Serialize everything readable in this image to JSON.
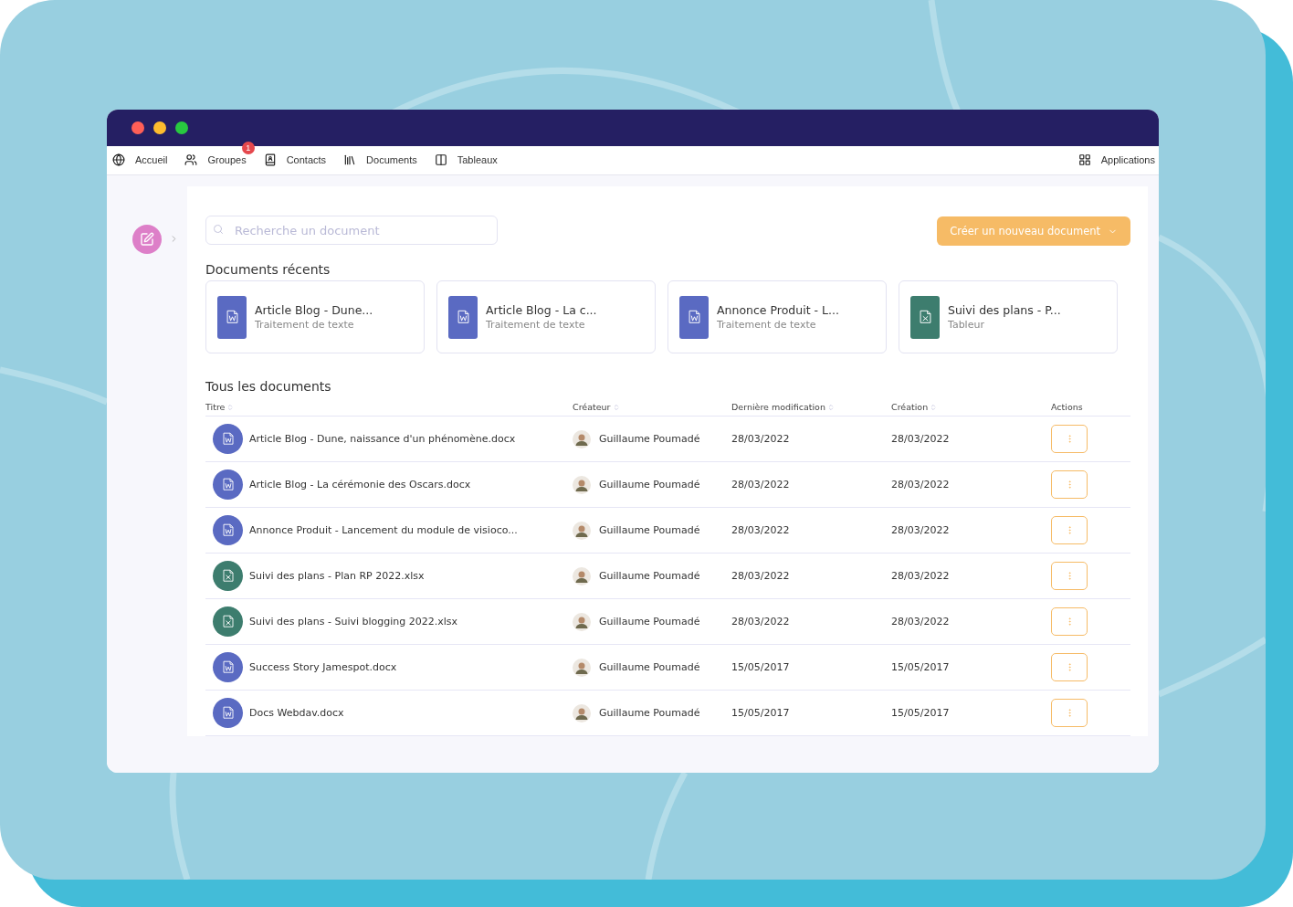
{
  "nav": {
    "items": [
      {
        "label": "Accueil"
      },
      {
        "label": "Groupes",
        "badge": "1"
      },
      {
        "label": "Contacts"
      },
      {
        "label": "Documents"
      },
      {
        "label": "Tableaux"
      }
    ],
    "apps": "Applications"
  },
  "search": {
    "placeholder": "Recherche un document"
  },
  "create_button": "Créer un nouveau document",
  "recent": {
    "title": "Documents récents",
    "items": [
      {
        "name": "Article Blog - Dune...",
        "type": "Traitement de texte",
        "kind": "word"
      },
      {
        "name": "Article Blog - La c...",
        "type": "Traitement de texte",
        "kind": "word"
      },
      {
        "name": "Annonce Produit - L...",
        "type": "Traitement de texte",
        "kind": "word"
      },
      {
        "name": "Suivi des plans - P...",
        "type": "Tableur",
        "kind": "sheet"
      }
    ]
  },
  "table": {
    "title": "Tous les documents",
    "columns": [
      "Titre",
      "Créateur",
      "Dernière modification",
      "Création",
      "Actions"
    ],
    "rows": [
      {
        "kind": "word",
        "title": "Article Blog - Dune, naissance d'un phénomène.docx",
        "creator": "Guillaume Poumadé",
        "modified": "28/03/2022",
        "created": "28/03/2022"
      },
      {
        "kind": "word",
        "title": "Article Blog - La cérémonie des Oscars.docx",
        "creator": "Guillaume Poumadé",
        "modified": "28/03/2022",
        "created": "28/03/2022"
      },
      {
        "kind": "word",
        "title": "Annonce Produit - Lancement du module de visioco...",
        "creator": "Guillaume Poumadé",
        "modified": "28/03/2022",
        "created": "28/03/2022"
      },
      {
        "kind": "sheet",
        "title": "Suivi des plans - Plan RP 2022.xlsx",
        "creator": "Guillaume Poumadé",
        "modified": "28/03/2022",
        "created": "28/03/2022"
      },
      {
        "kind": "sheet",
        "title": "Suivi des plans - Suivi blogging 2022.xlsx",
        "creator": "Guillaume Poumadé",
        "modified": "28/03/2022",
        "created": "28/03/2022"
      },
      {
        "kind": "word",
        "title": "Success Story Jamespot.docx",
        "creator": "Guillaume Poumadé",
        "modified": "15/05/2017",
        "created": "15/05/2017"
      },
      {
        "kind": "word",
        "title": "Docs Webdav.docx",
        "creator": "Guillaume Poumadé",
        "modified": "15/05/2017",
        "created": "15/05/2017"
      }
    ]
  }
}
